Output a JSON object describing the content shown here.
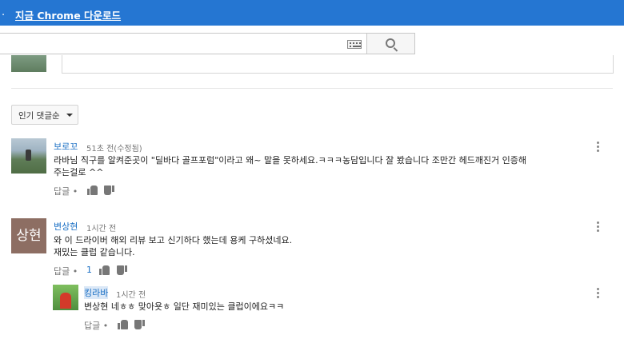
{
  "promo": {
    "dot": ".",
    "link": "지금 Chrome 다운로드"
  },
  "search": {
    "placeholder": ""
  },
  "sort": {
    "label": "인기 댓글순"
  },
  "comments": [
    {
      "author": "보로꼬",
      "time": "51초 전(수정됨)",
      "text_line1": "라바님 직구를 알켜준곳이 \"딜바다 골프포럼\"이라고 왜~ 말을 못하세요.ㅋㅋㅋ농담입니다 잘 봤습니다 조만간 헤드깨진거 인증해",
      "text_line2": "주는걸로 ^^",
      "reply_label": "답글 •"
    },
    {
      "author": "변상현",
      "avatar_text": "상현",
      "time": "1시간 전",
      "text_line1": "와 이 드라이버 해외 리뷰 보고 신기하다 했는데 용케 구하셨네요.",
      "text_line2": "재밌는 클럽 같습니다.",
      "reply_label": "답글 •",
      "like_count": "1",
      "reply": {
        "author": "킹라바",
        "time": "1시간 전",
        "text": "변상현 네ㅎㅎ 맞아욧ㅎ 일단 재미있는 클럽이에요ㅋㅋ",
        "reply_label": "답글 •"
      }
    }
  ]
}
